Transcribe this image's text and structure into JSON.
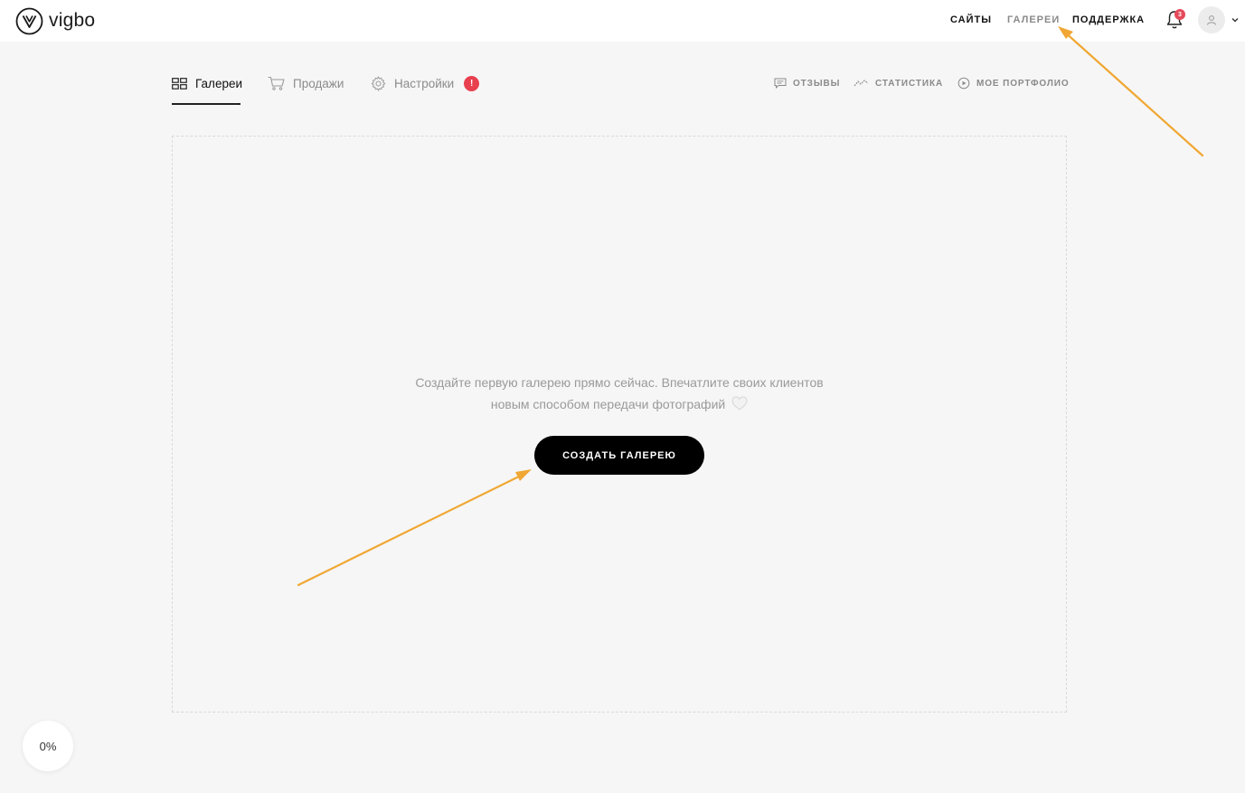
{
  "brand": {
    "name": "vigbo",
    "logo_icon": "vigbo-logo-icon"
  },
  "topnav": {
    "items": [
      {
        "label": "САЙТЫ",
        "active": false
      },
      {
        "label": "ГАЛЕРЕИ",
        "active": true
      },
      {
        "label": "ПОДДЕРЖКА",
        "active": false
      }
    ],
    "notifications_count": "3"
  },
  "tabs": [
    {
      "label": "Галереи",
      "icon": "grid-icon",
      "active": true
    },
    {
      "label": "Продажи",
      "icon": "cart-icon",
      "active": false
    },
    {
      "label": "Настройки",
      "icon": "gear-icon",
      "active": false,
      "alert": "!"
    }
  ],
  "right_links": [
    {
      "label": "ОТЗЫВЫ",
      "icon": "comment-icon"
    },
    {
      "label": "СТАТИСТИКА",
      "icon": "chart-line-icon"
    },
    {
      "label": "МОЕ ПОРТФОЛИО",
      "icon": "eye-icon"
    }
  ],
  "empty_state": {
    "line1": "Создайте первую галерею прямо сейчас. Впечатлите своих клиентов",
    "line2": "новым способом передачи фотографий",
    "emoji_icon": "white-heart-icon",
    "button_label": "СОЗДАТЬ ГАЛЕРЕЮ"
  },
  "progress": {
    "label": "0%"
  },
  "colors": {
    "accent_arrow": "#f0a733",
    "alert_red": "#e8404f",
    "button_black": "#000000"
  }
}
